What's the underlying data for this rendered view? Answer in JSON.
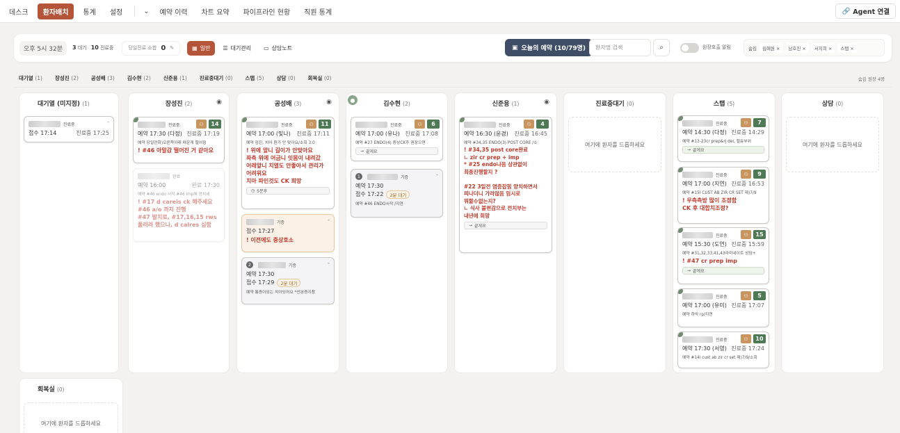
{
  "nav": {
    "items": [
      "데스크",
      "환자배치",
      "통계",
      "설정"
    ],
    "more": [
      "예약 이력",
      "차트 요약",
      "파이프라인 현황",
      "직원 통계"
    ],
    "agent": "Agent 연결"
  },
  "toolbar": {
    "time": "오후 5시 32분",
    "waiting_count": "3",
    "waiting_label": "대기",
    "treating_count": "10",
    "treating_label": "진료중",
    "today_label": "당일진료 소합",
    "today_value": "0",
    "modes": [
      "일반",
      "대기관리",
      "상담노트"
    ],
    "today_resv": "오늘의 예약 (10/79명)",
    "search_placeholder": "환자명 검색",
    "alarm_label": "원장호출 알림",
    "staff_label": "숨김",
    "staff_chips": [
      "김혜원 ×",
      "남호진 ×",
      "서지희 ×",
      "스탭 ×"
    ]
  },
  "tabs": [
    {
      "name": "대기열",
      "count": "(1)"
    },
    {
      "name": "장성진",
      "count": "(2)"
    },
    {
      "name": "공성배",
      "count": "(3)"
    },
    {
      "name": "김수현",
      "count": "(2)"
    },
    {
      "name": "신준용",
      "count": "(1)"
    },
    {
      "name": "진료중대기",
      "count": "(0)"
    },
    {
      "name": "스탭",
      "count": "(5)"
    },
    {
      "name": "상담",
      "count": "(0)"
    },
    {
      "name": "회복실",
      "count": "(0)"
    }
  ],
  "tabs_note": "숨김 원장 4명",
  "drop_text": "여기에 환자를 드롭하세요",
  "columns": {
    "queue": {
      "title": "대기열 (미지정)",
      "count": "(1)"
    },
    "jang": {
      "title": "장성진",
      "count": "(2)"
    },
    "gong": {
      "title": "공성배",
      "count": "(3)"
    },
    "kim": {
      "title": "김수현",
      "count": "(2)"
    },
    "shin": {
      "title": "신준용",
      "count": "(1)"
    },
    "wait": {
      "title": "진료중대기",
      "count": "(0)"
    },
    "staff": {
      "title": "스탭",
      "count": "(5)"
    },
    "consult": {
      "title": "상담",
      "count": "(0)"
    },
    "recovery": {
      "title": "회복실",
      "count": "(0)"
    }
  },
  "cards": {
    "q1": {
      "role": "진료중",
      "dash": "-",
      "left": "접수 17:14",
      "right": "진료중 17:25"
    },
    "j1": {
      "role": "진료중",
      "num": "14",
      "left": "예약 17:30 (다정)",
      "right": "진료중 17:19",
      "note": "예약 당일전화)오른쪽아래 매운게 떨어짐",
      "alert": "! #46 아말감 떨어진 거 같아요"
    },
    "j2": {
      "role": "완료",
      "left": "예약 16:00",
      "right": "완료 17:30",
      "note": "예약 #46 endo 시작 #46 imp에 양치세",
      "alert": "! #17 d careis ck 해주세요\n#46 a/o 까지 진행\n#47 발치로, #17,16,15 rws\n풀러려 했으나, d caires 심함"
    },
    "g1": {
      "role": "진료중",
      "num": "11",
      "left": "예약 17:00 (빛나)",
      "right": "진료중 17:11",
      "note": "예약 검진, 치아 환가 안 맞아요/소회 3:0",
      "alert": "! 위에 앞니 길이가 안맞아요\n좌측 위에 어금니 잇몸이 내려갔\n어래앞니 치열도 안좋아서 관리가\n어려워요\n치아 파인것도 CK 희망",
      "btn": "5분후"
    },
    "g2": {
      "role": "기증",
      "dash": "-",
      "left": "접수 17:27",
      "alert": "! 이전에도 증상호소"
    },
    "g3": {
      "qnum": "2",
      "role": "기증",
      "dash": "-",
      "line1": "예약 17:30",
      "left": "접수 17:29",
      "wait": "2분 대기",
      "note": "예약 통증이있는 치아있어요 *신분증지참"
    },
    "k1": {
      "role": "진료중",
      "num": "6",
      "left": "예약 17:00 (유나)",
      "right": "진료중 17:08",
      "note": "예약 #27 ENDO(4) 증상CK후 권장으면",
      "btn": "끝게요"
    },
    "k2": {
      "qnum": "1",
      "role": "기증",
      "dash": "-",
      "line1": "예약 17:30",
      "left": "접수 17:22",
      "wait": "2분 대기",
      "note": "예약 #46 ENDO시작 /지연"
    },
    "s1": {
      "role": "진료중",
      "num": "4",
      "left": "예약 16:30 (윤경)",
      "right": "진료중 16:45",
      "note": "예약 #34,35 ENDO(3) POST CORE /소",
      "alert": "! #34,35 post core완료\n∟ zir cr prep + imp\n* #25 endo냐음 상관없이\n최종진행할지 ?\n\n#22 3일전 염증잡힘 양치하면서\n피나더니 가라않음 임시로\n뭐할수없는지?\n∟ 식사 불편감으로 전치부는\n내년에 희망",
      "btn": "끝게요"
    },
    "st1": {
      "role": "진료중",
      "num": "7",
      "left": "예약 14:30 (다정)",
      "right": "진료중 14:29",
      "note": "예약 #13-23cr prep&rj del, 헐유부위",
      "btn": "끝게요"
    },
    "st2": {
      "role": "진료중",
      "num": "9",
      "left": "예약 17:00 (지연)",
      "right": "진료중 16:53",
      "note": "예약 #15I CUST AB ZIR CR SET 제)7/9",
      "alert": "! 우측측방 많이 조정함\nCK 후 대합치조정?"
    },
    "st3": {
      "role": "진료중",
      "num": "15",
      "left": "예약 15:30 (도연)",
      "right": "진료중 15:59",
      "note": "예약 #31,32,33,41,43라미네이트 상담+",
      "alert": "! #47 cr prep imp",
      "btn": "끝게요"
    },
    "st4": {
      "role": "진료중",
      "num": "5",
      "left": "예약 17:00 (유미)",
      "right": "진료중 17:07",
      "note": "예약 하악 rp/지연"
    },
    "st5": {
      "role": "진료중",
      "num": "10",
      "left": "예약 17:30 (서영)",
      "right": "진료중 17:24",
      "note": "예약 #14i cust ab zir cr set 제)7/9/소회"
    }
  }
}
